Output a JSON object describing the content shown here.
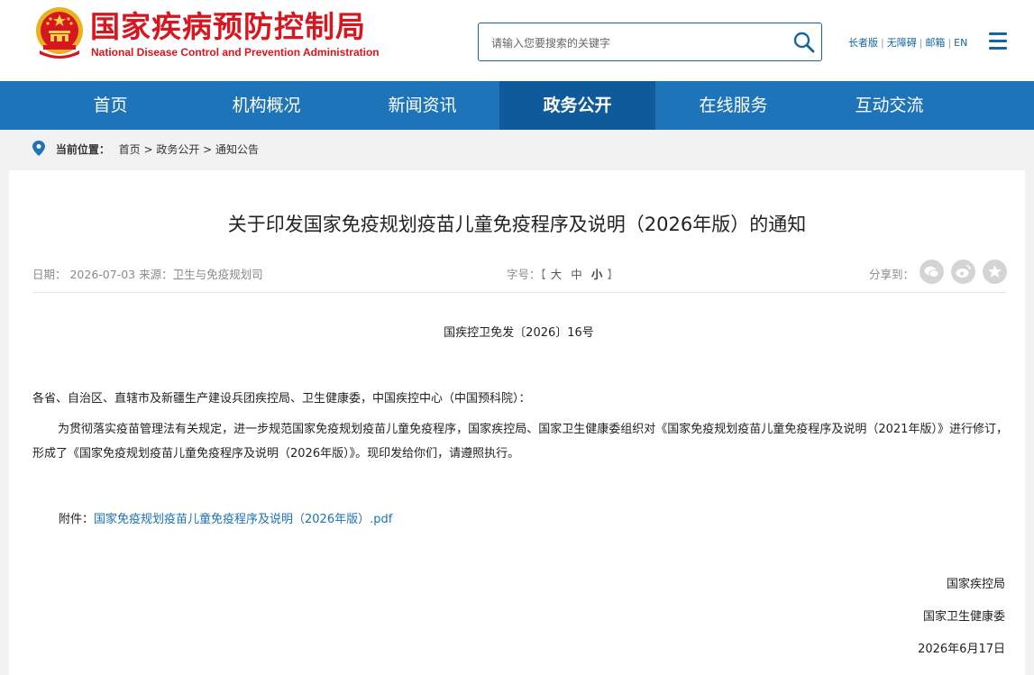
{
  "header": {
    "logo_cn": "国家疾病预防控制局",
    "logo_en": "National Disease Control and Prevention Administration",
    "search_placeholder": "请输入您要搜索的关键字",
    "links": [
      "长者版",
      "无障碍",
      "邮箱",
      "EN"
    ]
  },
  "nav": {
    "items": [
      "首页",
      "机构概况",
      "新闻资讯",
      "政务公开",
      "在线服务",
      "互动交流"
    ],
    "active": "政务公开"
  },
  "breadcrumb": {
    "label": "当前位置：",
    "path": "首页 > 政务公开 > 通知公告"
  },
  "article": {
    "title": "关于印发国家免疫规划疫苗儿童免疫程序及说明（2026年版）的通知",
    "meta": "日期： 2026-07-03 来源：卫生与免疫规划司",
    "font_size_label": "字号：",
    "font_sizes": [
      "大",
      "中",
      "小"
    ],
    "share_label": "分享到：",
    "doc_number": "国疾控卫免发〔2026〕16号",
    "addressee": "各省、自治区、直辖市及新疆生产建设兵团疾控局、卫生健康委，中国疾控中心（中国预科院）：",
    "body": "为贯彻落实疫苗管理法有关规定，进一步规范国家免疫规划疫苗儿童免疫程序，国家疾控局、国家卫生健康委组织对《国家免疫规划疫苗儿童免疫程序及说明（2021年版）》进行修订，形成了《国家免疫规划疫苗儿童免疫程序及说明（2026年版）》。现印发给你们，请遵照执行。",
    "attachment_label": "附件：",
    "attachment_link": "国家免疫规划疫苗儿童免疫程序及说明（2026年版）.pdf",
    "signatory_1": "国家疾控局",
    "signatory_2": "国家卫生健康委",
    "sign_date": "2026年6月17日"
  },
  "colors": {
    "brand_red": "#d7161f",
    "nav_blue": "#1d74b8",
    "nav_active": "#0e5a9a",
    "link_blue": "#1d6fb8"
  }
}
